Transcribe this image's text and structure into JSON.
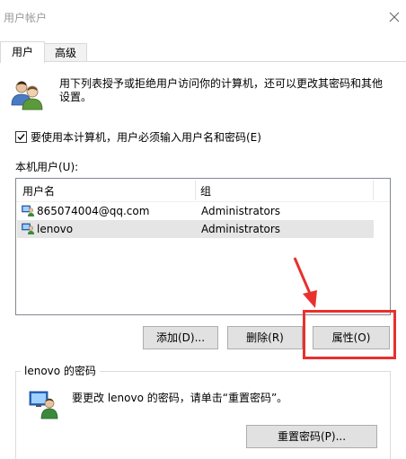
{
  "window": {
    "title": "用户帐户",
    "close_icon": "close-icon"
  },
  "tabs": [
    {
      "label": "用户",
      "active": true
    },
    {
      "label": "高级",
      "active": false
    }
  ],
  "intro": {
    "icon": "users-icon",
    "text": "用下列表授予或拒绝用户访问你的计算机，还可以更改其密码和其他设置。"
  },
  "require_login": {
    "checked": true,
    "label": "要使用本计算机，用户必须输入用户名和密码(E)"
  },
  "users_list": {
    "label": "本机用户(U):",
    "columns": [
      "用户名",
      "组"
    ],
    "rows": [
      {
        "name": "865074004@qq.com",
        "group": "Administrators",
        "selected": false
      },
      {
        "name": "lenovo",
        "group": "Administrators",
        "selected": true
      }
    ]
  },
  "buttons": {
    "add": "添加(D)...",
    "remove": "删除(R)",
    "properties": "属性(O)"
  },
  "password_section": {
    "legend": "lenovo 的密码",
    "text": "要更改 lenovo 的密码，请单击“重置密码”。",
    "reset_button": "重置密码(P)..."
  },
  "colors": {
    "highlight": "#e8312e",
    "selection": "#e5e5e5",
    "button_bg": "#e1e1e1"
  }
}
